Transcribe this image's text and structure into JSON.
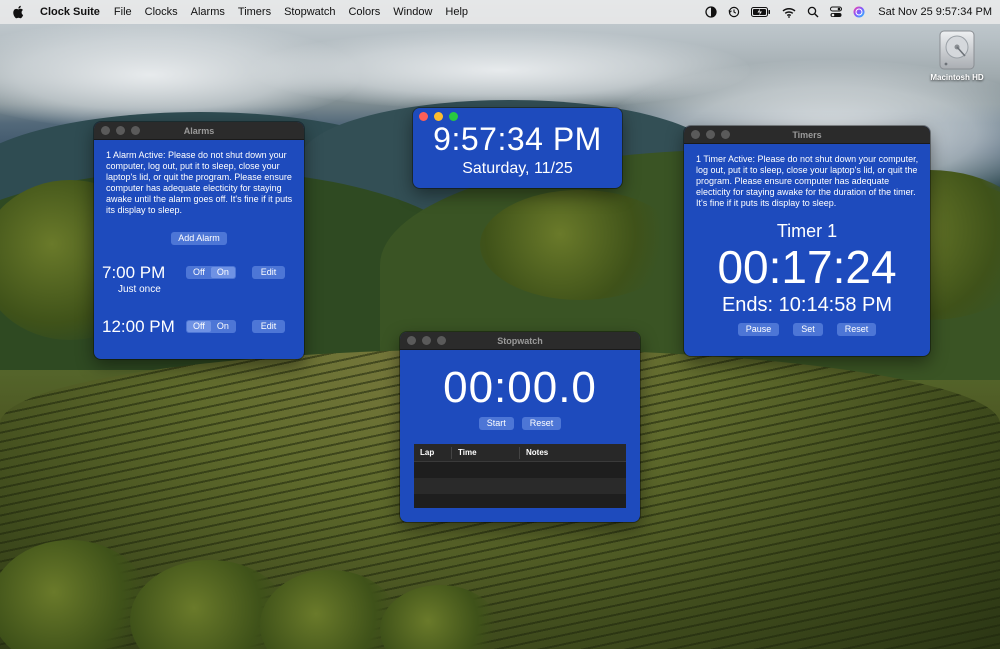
{
  "menubar": {
    "app_name": "Clock Suite",
    "items": [
      "File",
      "Clocks",
      "Alarms",
      "Timers",
      "Stopwatch",
      "Colors",
      "Window",
      "Help"
    ],
    "datetime": "Sat Nov 25  9:57:34 PM"
  },
  "desktop": {
    "drive_label": "Macintosh HD"
  },
  "alarms_window": {
    "title": "Alarms",
    "notice": "1 Alarm Active: Please do not shut down your computer, log out, put it to sleep, close your laptop's lid, or quit the program.  Please ensure computer has adequate electicity for staying awake until the alarm goes off.  It's fine if it puts its display to sleep.",
    "add_label": "Add Alarm",
    "alarms": [
      {
        "time": "7:00 PM",
        "repeat": "Just once",
        "off_label": "Off",
        "on_label": "On",
        "enabled": true,
        "edit_label": "Edit"
      },
      {
        "time": "12:00 PM",
        "repeat": "",
        "off_label": "Off",
        "on_label": "On",
        "enabled": false,
        "edit_label": "Edit"
      }
    ]
  },
  "clock_window": {
    "time": "9:57:34 PM",
    "date": "Saturday, 11/25"
  },
  "timers_window": {
    "title": "Timers",
    "notice": "1 Timer Active: Please do not shut down your computer, log out, put it to sleep, close your laptop's lid, or quit the program.  Please ensure computer has adequate electicity for staying awake for the duration of the timer.  It's fine if it puts its display to sleep.",
    "timer_name": "Timer 1",
    "remaining": "00:17:24",
    "ends": "Ends: 10:14:58 PM",
    "pause_label": "Pause",
    "set_label": "Set",
    "reset_label": "Reset"
  },
  "stopwatch_window": {
    "title": "Stopwatch",
    "elapsed": "00:00.0",
    "start_label": "Start",
    "reset_label": "Reset",
    "columns": [
      "Lap",
      "Time",
      "Notes"
    ],
    "laps": []
  },
  "colors": {
    "window_bg": "#1e4bbd",
    "button_bg": "#4d76d6"
  }
}
